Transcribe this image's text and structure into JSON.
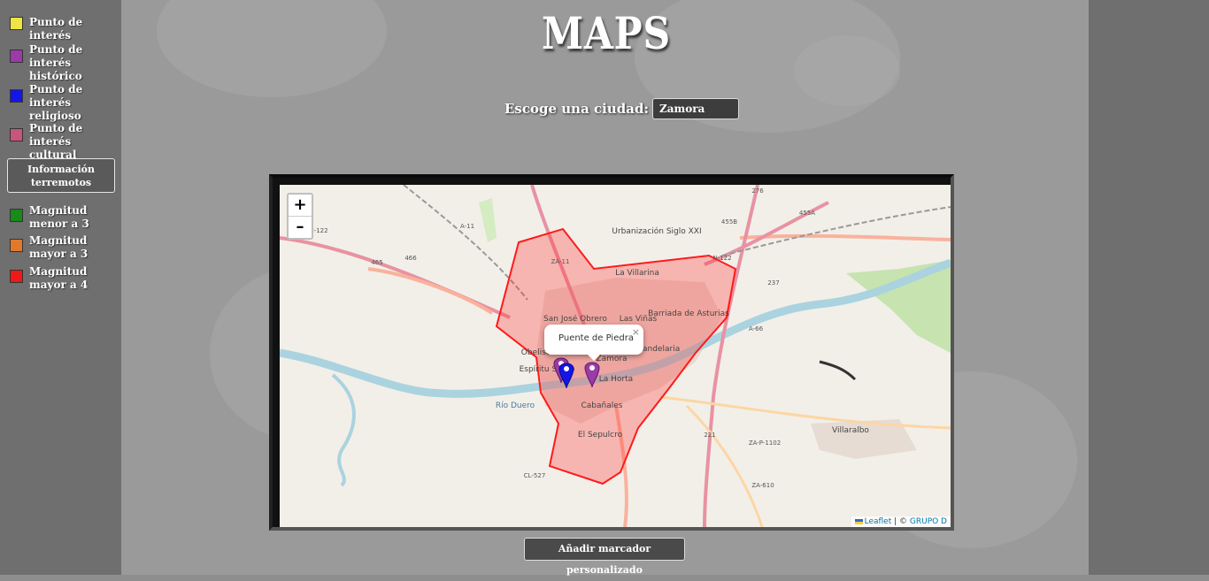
{
  "legend": {
    "points": [
      {
        "label": "Punto de interés",
        "color": "#f0e442"
      },
      {
        "label": "Punto de interés histórico",
        "color": "#9a3ba8"
      },
      {
        "label": "Punto de interés religioso",
        "color": "#1515e8"
      },
      {
        "label": "Punto de interés cultural",
        "color": "#c8557a"
      }
    ],
    "earthquake_button": "Información terremotos",
    "magnitudes": [
      {
        "label": "Magnitud menor a 3",
        "color": "#1a8a1a"
      },
      {
        "label": "Magnitud mayor a 3",
        "color": "#e07a2a"
      },
      {
        "label": "Magnitud mayor a 4",
        "color": "#f01818"
      }
    ]
  },
  "header": {
    "title": "MAPS",
    "city_label": "Escoge una ciudad:",
    "city_selected": "Zamora"
  },
  "map": {
    "zoom_in": "+",
    "zoom_out": "–",
    "popup_text": "Puente de Piedra",
    "popup_close": "×",
    "attribution_leaflet": "Leaflet",
    "attribution_sep": " | © ",
    "attribution_group": "GRUPO D",
    "places": [
      "Urbanización Siglo XXI",
      "La Villarina",
      "San José Obrero",
      "Las Viñas",
      "Barriada de Asturias",
      "Candelaria",
      "Obelisco",
      "Espíritu Santo",
      "Zamora",
      "La Horta",
      "Cabañales",
      "El Sepulcro",
      "Villaralbo",
      "Río Duero"
    ],
    "road_labels": [
      "N-122",
      "A-11",
      "ZA-11",
      "N-122",
      "A-66",
      "ZA-P-1102",
      "ZA-610",
      "CL-527",
      "221",
      "237",
      "276",
      "455B",
      "455A",
      "465",
      "466"
    ],
    "polygon_color": "#ff3030",
    "marker_colors": [
      "#9a3ba8",
      "#1515e8",
      "#9a3ba8"
    ]
  },
  "footer": {
    "add_marker_button": "Añadir marcador personalizado"
  }
}
